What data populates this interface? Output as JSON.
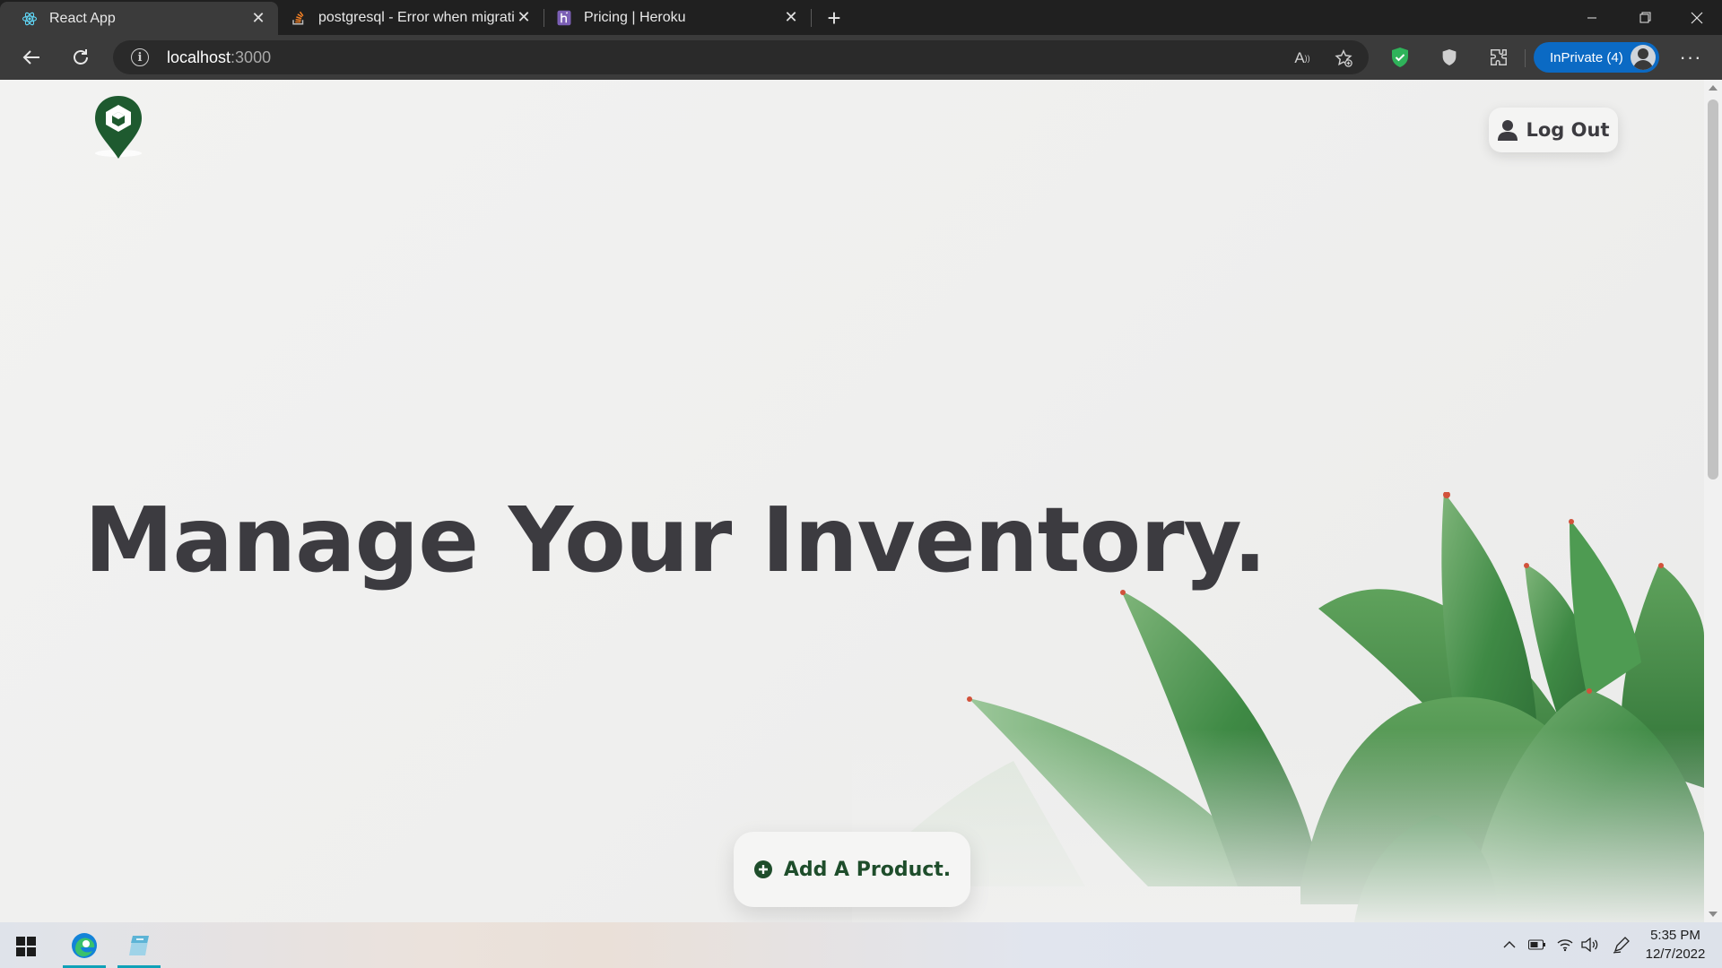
{
  "browser": {
    "tabs": [
      {
        "title": "React App",
        "icon": "react-icon",
        "active": true
      },
      {
        "title": "postgresql - Error when migratin",
        "icon": "stackoverflow-icon",
        "active": false
      },
      {
        "title": "Pricing | Heroku",
        "icon": "heroku-icon",
        "active": false
      }
    ],
    "new_tab": "+",
    "address": {
      "host": "localhost",
      "port": ":3000"
    },
    "inprivate_label": "InPrivate (4)",
    "more": "···"
  },
  "page": {
    "logout_label": "Log Out",
    "hero_title": "Manage Your Inventory.",
    "add_product_label": "Add A Product."
  },
  "taskbar": {
    "time": "5:35 PM",
    "date": "12/7/2022"
  },
  "colors": {
    "page_bg": "#efefee",
    "heading": "#3c3b40",
    "brand_green": "#1e5a2f",
    "button_text_green": "#1e4d2b",
    "inprivate_blue": "#0b6ac4"
  }
}
